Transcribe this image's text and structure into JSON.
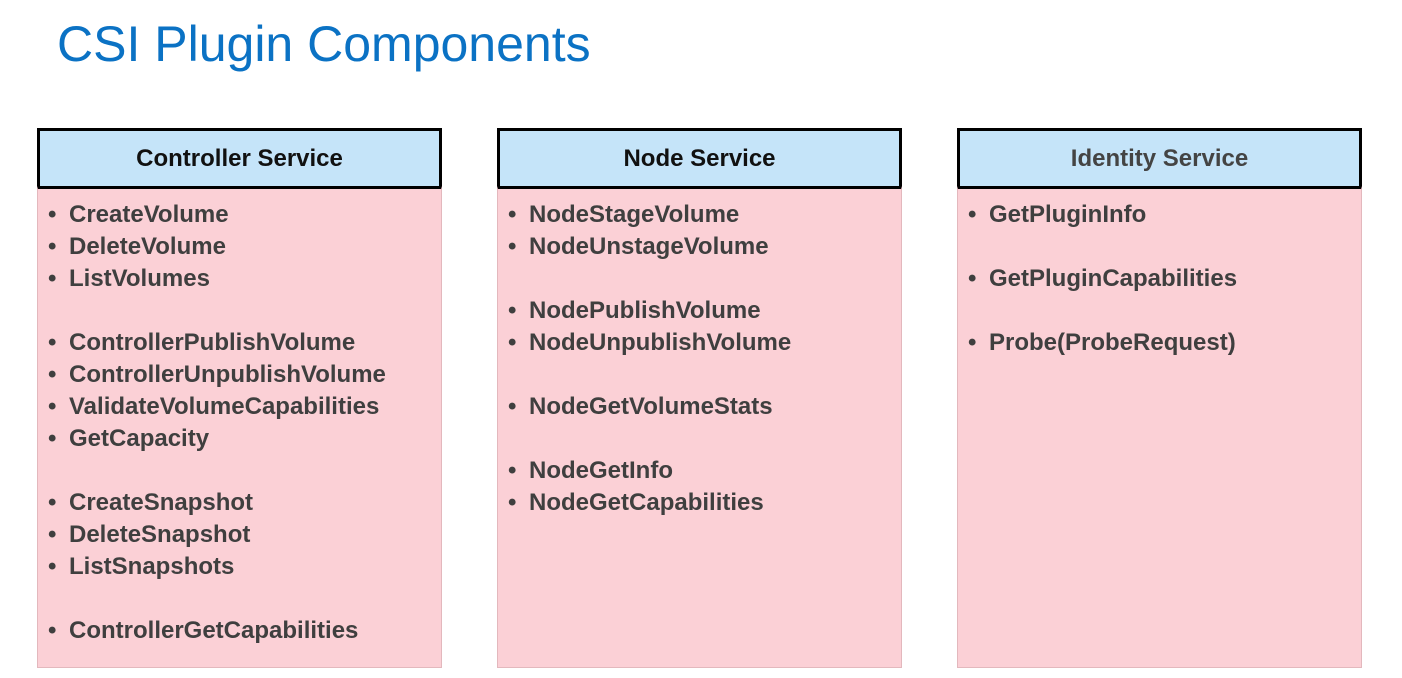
{
  "title": "CSI Plugin Components",
  "columns": [
    {
      "header": "Controller Service",
      "groups": [
        [
          "CreateVolume",
          "DeleteVolume",
          "ListVolumes"
        ],
        [
          "ControllerPublishVolume",
          "ControllerUnpublishVolume",
          "ValidateVolumeCapabilities",
          "GetCapacity"
        ],
        [
          "CreateSnapshot",
          "DeleteSnapshot",
          "ListSnapshots"
        ],
        [
          "ControllerGetCapabilities"
        ]
      ]
    },
    {
      "header": "Node Service",
      "groups": [
        [
          "NodeStageVolume",
          "NodeUnstageVolume"
        ],
        [
          "NodePublishVolume",
          "NodeUnpublishVolume"
        ],
        [
          "NodeGetVolumeStats"
        ],
        [
          "NodeGetInfo",
          "NodeGetCapabilities"
        ]
      ]
    },
    {
      "header": "Identity Service",
      "groups": [
        [
          "GetPluginInfo"
        ],
        [
          "GetPluginCapabilities"
        ],
        [
          "Probe(ProbeRequest)"
        ]
      ]
    }
  ],
  "colors": {
    "title": "#0b72c4",
    "header_bg": "#c5e4f9",
    "body_bg": "#fbd0d6",
    "text": "#3f3f3f"
  }
}
